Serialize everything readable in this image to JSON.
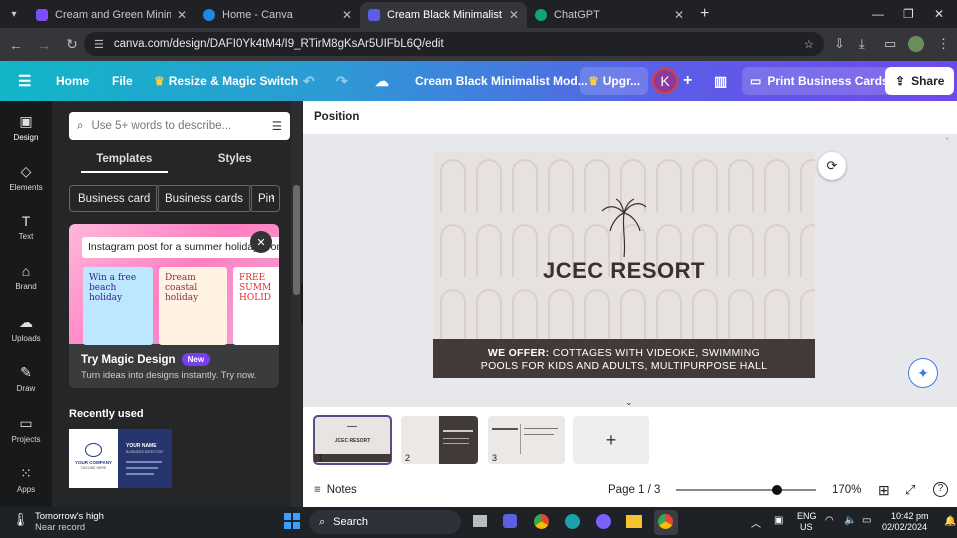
{
  "browser": {
    "tabs": [
      {
        "title": "Cream and Green Minimal Crea",
        "favicon_color": "#7c4dff"
      },
      {
        "title": "Home - Canva",
        "favicon_color": "#1e88e5"
      },
      {
        "title": "Cream Black Minimalist Moder",
        "favicon_color": "#5b5de8"
      },
      {
        "title": "ChatGPT",
        "favicon_color": "#10a37f"
      }
    ],
    "url": "canva.com/design/DAFI0Yk4tM4/I9_RTirM8gKsAr5UIFbL6Q/edit"
  },
  "canva": {
    "home": "Home",
    "file": "File",
    "resize": "Resize & Magic Switch",
    "doc_title": "Cream Black Minimalist Mod...",
    "upgrade": "Upgr...",
    "avatar_letter": "K",
    "print": "Print Business Cards",
    "share": "Share"
  },
  "rail": [
    {
      "label": "Design"
    },
    {
      "label": "Elements"
    },
    {
      "label": "Text"
    },
    {
      "label": "Brand"
    },
    {
      "label": "Uploads"
    },
    {
      "label": "Draw"
    },
    {
      "label": "Projects"
    },
    {
      "label": "Apps"
    }
  ],
  "panel": {
    "search_placeholder": "Use 5+ words to describe...",
    "tab_templates": "Templates",
    "tab_styles": "Styles",
    "chips": [
      "Business card",
      "Business cards",
      "Pin"
    ],
    "promo_prompt": "Instagram post for a summer holiday promo",
    "promo_cards": [
      "Win a free beach holiday",
      "Dream coastal holiday",
      "FREE SUMM HOLID"
    ],
    "promo_title": "Try Magic Design",
    "promo_badge": "New",
    "promo_sub": "Turn ideas into designs instantly. Try now.",
    "recent_title": "Recently used",
    "recent_card": {
      "company": "YOUR COMPANY",
      "tagline": "TAGLINE HERE",
      "name": "YOUR NAME",
      "title": "BUSINESS DIRECTOR"
    }
  },
  "editor": {
    "position": "Position",
    "resort": "JCEC RESORT",
    "offer_bold": "WE OFFER:",
    "offer_line1": "COTTAGES WITH VIDEOKE, SWIMMING",
    "offer_line2": "POOLS FOR KIDS AND ADULTS, MULTIPURPOSE HALL",
    "pages": [
      {
        "num": "1"
      },
      {
        "num": "2"
      },
      {
        "num": "3"
      }
    ],
    "add_page": "+",
    "notes": "Notes",
    "page_indicator": "Page 1 / 3",
    "zoom": "170%",
    "zoom_fraction": 0.72
  },
  "taskbar": {
    "weather": "Tomorrow's high",
    "weather_sub": "Near record",
    "search": "Search",
    "lang": "ENG",
    "region": "US",
    "time": "10:42 pm",
    "date": "02/02/2024"
  }
}
